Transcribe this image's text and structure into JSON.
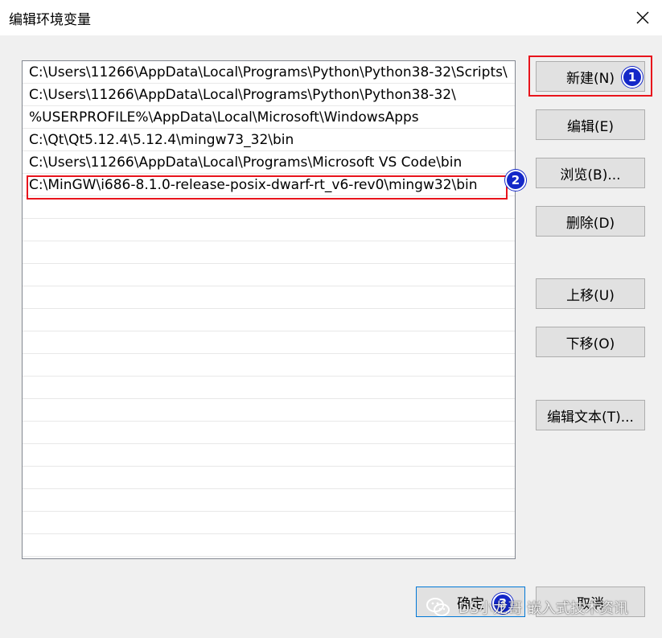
{
  "window": {
    "title": "编辑环境变量",
    "close_icon": "close-icon"
  },
  "list": {
    "items": [
      "C:\\Users\\11266\\AppData\\Local\\Programs\\Python\\Python38-32\\Scripts\\",
      "C:\\Users\\11266\\AppData\\Local\\Programs\\Python\\Python38-32\\",
      "%USERPROFILE%\\AppData\\Local\\Microsoft\\WindowsApps",
      "C:\\Qt\\Qt5.12.4\\5.12.4\\mingw73_32\\bin",
      "C:\\Users\\11266\\AppData\\Local\\Programs\\Microsoft VS Code\\bin",
      "C:\\MinGW\\i686-8.1.0-release-posix-dwarf-rt_v6-rev0\\mingw32\\bin"
    ],
    "selected_index": 5
  },
  "buttons": {
    "new": "新建(N)",
    "edit": "编辑(E)",
    "browse": "浏览(B)...",
    "delete": "删除(D)",
    "move_up": "上移(U)",
    "move_down": "下移(O)",
    "edit_text": "编辑文本(T)...",
    "ok": "确定",
    "cancel": "取消"
  },
  "annotations": {
    "badge_1": "1",
    "badge_2": "2",
    "badge_3": "3",
    "highlight_color": "#e8141c",
    "badge_color": "#1428c8"
  },
  "watermark": {
    "text": "DS小龙哥 嵌入式技术资讯",
    "icon": "wechat-icon"
  }
}
